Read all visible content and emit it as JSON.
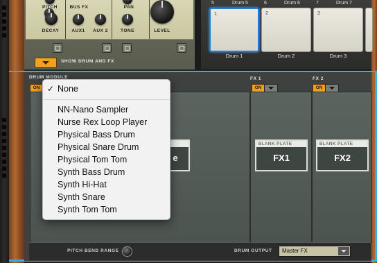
{
  "top_panel": {
    "knob_labels": [
      "PITCH",
      "DECAY",
      "BUS FX",
      "AUX1",
      "AUX 2",
      "PAN",
      "TONE",
      "LEVEL"
    ],
    "show_drum_fx_label": "SHOW DRUM AND FX"
  },
  "drum_pads": {
    "top_numbers": [
      "5",
      "6",
      "7"
    ],
    "top_labels": [
      "Drum 5",
      "Drum 6",
      "Drum 7"
    ],
    "pads": [
      {
        "number": "1",
        "label": "Drum 1",
        "selected": true
      },
      {
        "number": "2",
        "label": "Drum 2",
        "selected": false
      },
      {
        "number": "3",
        "label": "Drum 3",
        "selected": false
      }
    ]
  },
  "device": {
    "drum_module_label": "DRUM MODULE",
    "fx1_label": "FX 1",
    "fx2_label": "FX 2",
    "on_label": "ON",
    "plates": [
      {
        "header": "BLANK PLATE",
        "name": "FX1"
      },
      {
        "header": "BLANK PLATE",
        "name": "FX2"
      }
    ],
    "partial_plate_name": "e",
    "pitch_bend_label": "PITCH BEND RANGE",
    "drum_output_label": "DRUM OUTPUT",
    "drum_output_value": "Master FX"
  },
  "menu": {
    "selected": "None",
    "items": [
      "None",
      "NN-Nano Sampler",
      "Nurse Rex Loop Player",
      "Physical Bass Drum",
      "Physical Snare Drum",
      "Physical Tom Tom",
      "Synth Bass Drum",
      "Synth Hi-Hat",
      "Synth Snare",
      "Synth Tom Tom"
    ],
    "check_mark": "✓"
  },
  "colors": {
    "accent_orange": "#f0a020",
    "selection_blue": "#1f7fd8",
    "highlight_cyan": "#29b4e6"
  }
}
